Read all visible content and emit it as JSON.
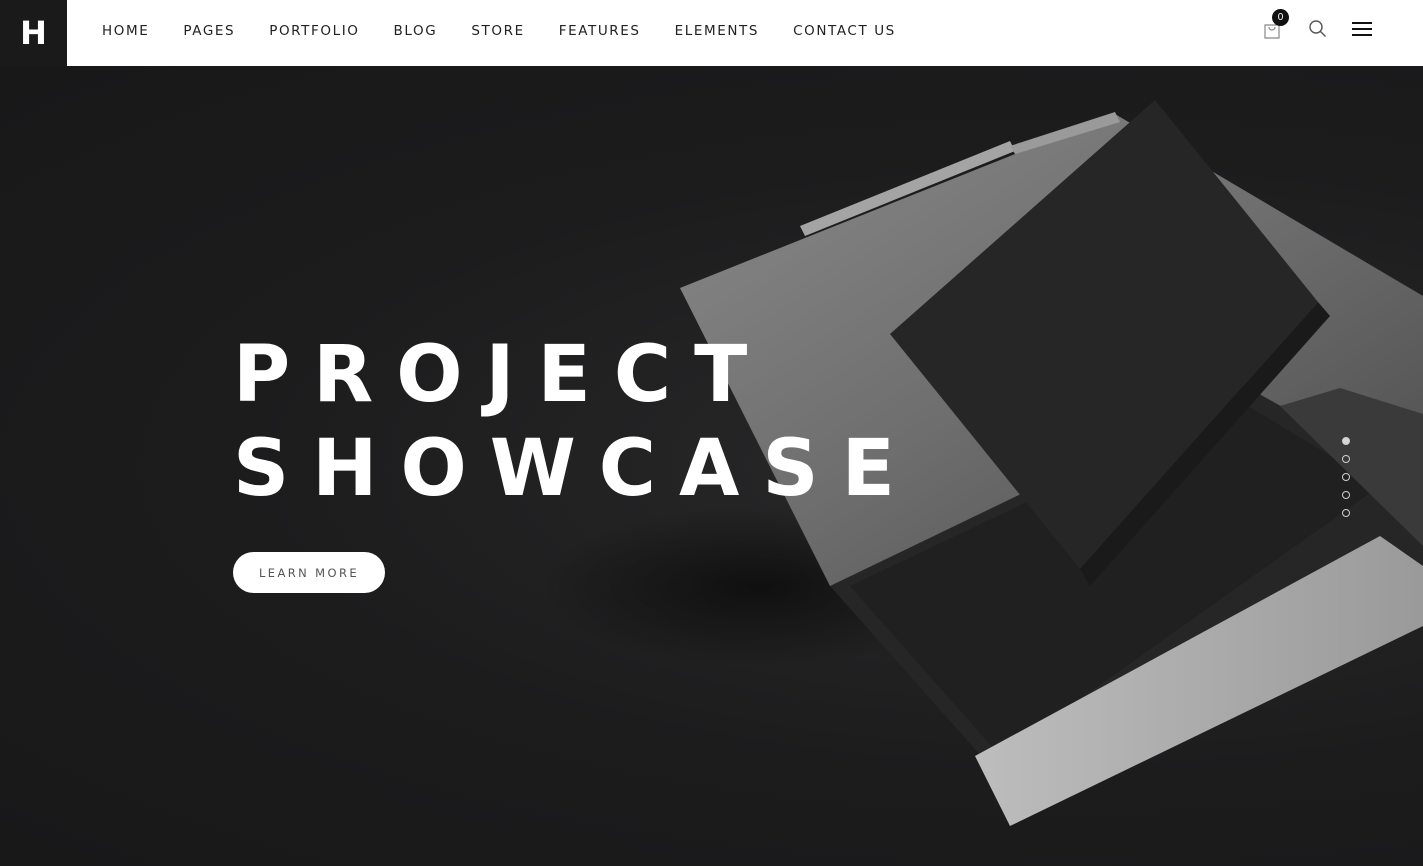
{
  "brand": {
    "logo_letter": "H"
  },
  "nav": {
    "items": [
      {
        "label": "HOME"
      },
      {
        "label": "PAGES"
      },
      {
        "label": "PORTFOLIO"
      },
      {
        "label": "BLOG"
      },
      {
        "label": "STORE"
      },
      {
        "label": "FEATURES"
      },
      {
        "label": "ELEMENTS"
      },
      {
        "label": "CONTACT US"
      }
    ]
  },
  "header_icons": {
    "cart_icon": "shopping-bag-icon",
    "cart_count": "0",
    "search_icon": "search-icon",
    "menu_icon": "hamburger-menu-icon"
  },
  "hero": {
    "title_line1": "PROJECT",
    "title_line2": "SHOWCASE",
    "cta_label": "LEARN MORE",
    "slider_dots": {
      "count": 5,
      "active_index": 0
    }
  },
  "colors": {
    "header_bg": "#ffffff",
    "logo_bg": "#1a1a1a",
    "hero_bg": "#1b1b1c",
    "title_text": "#ffffff",
    "cta_bg": "#ffffff"
  }
}
